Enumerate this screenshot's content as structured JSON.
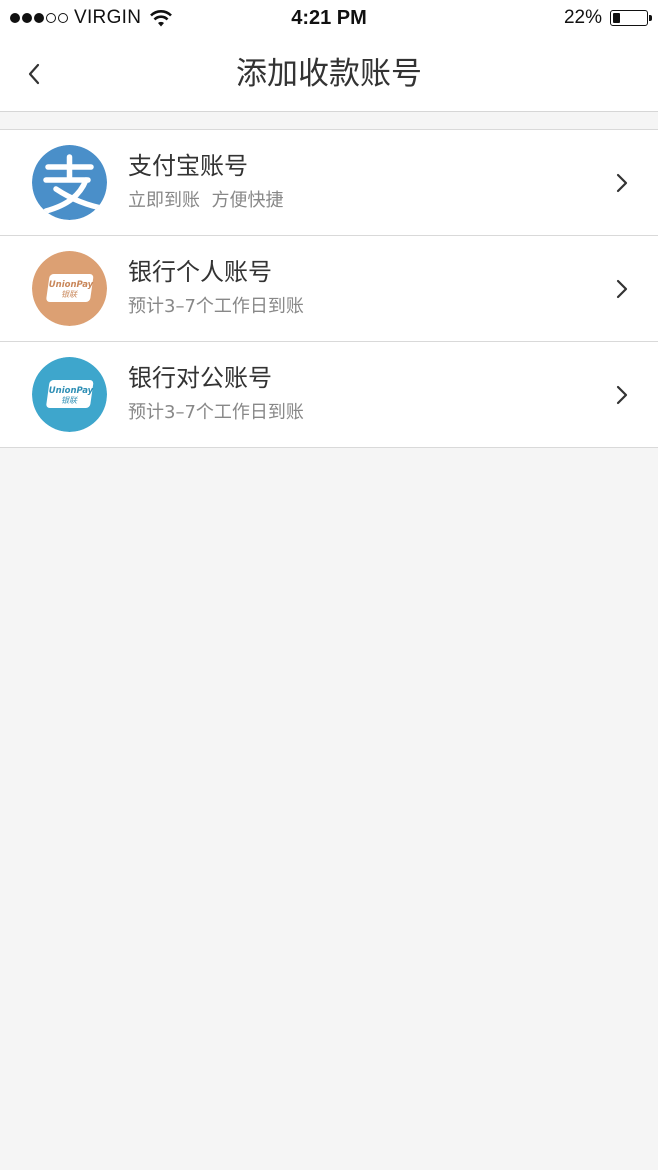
{
  "status_bar": {
    "carrier": "VIRGIN",
    "time": "4:21 PM",
    "battery_percent_label": "22%",
    "battery_level": 0.22,
    "signal_strength": 3,
    "signal_max": 5
  },
  "nav": {
    "title": "添加收款账号",
    "back_icon": "chevron-left-icon"
  },
  "accounts": [
    {
      "title": "支付宝账号",
      "subtitle": "立即到账  方便快捷",
      "icon": "alipay-icon",
      "color": "#4a8fc9"
    },
    {
      "title": "银行个人账号",
      "subtitle": "预计3–7个工作日到账",
      "icon": "unionpay-icon",
      "card_text": "UnionPay",
      "card_text_cn": "银联",
      "color": "#dca073"
    },
    {
      "title": "银行对公账号",
      "subtitle": "预计3–7个工作日到账",
      "icon": "unionpay-icon",
      "card_text": "UnionPay",
      "card_text_cn": "银联",
      "color": "#3ea6cc"
    }
  ]
}
